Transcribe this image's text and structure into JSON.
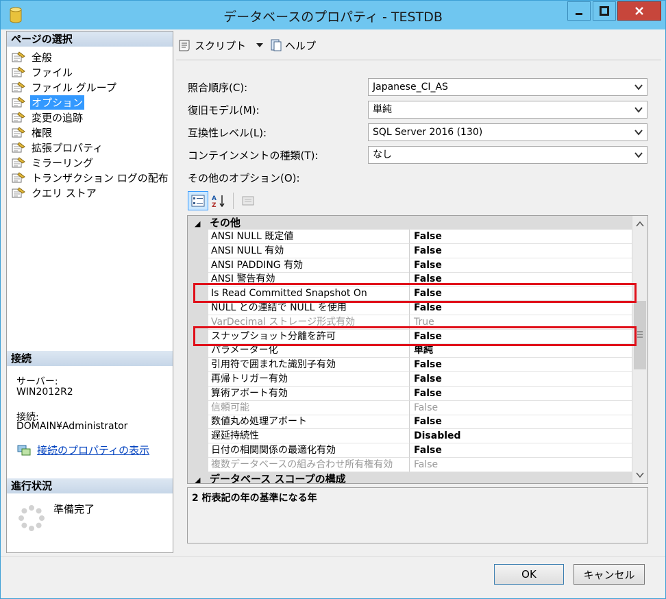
{
  "window": {
    "title": "データベースのプロパティ - TESTDB"
  },
  "left": {
    "page_select_header": "ページの選択",
    "nav_items": [
      {
        "label": "全般"
      },
      {
        "label": "ファイル"
      },
      {
        "label": "ファイル グループ"
      },
      {
        "label": "オプション",
        "selected": true
      },
      {
        "label": "変更の追跡"
      },
      {
        "label": "権限"
      },
      {
        "label": "拡張プロパティ"
      },
      {
        "label": "ミラーリング"
      },
      {
        "label": "トランザクション ログの配布"
      },
      {
        "label": "クエリ ストア"
      }
    ],
    "connection_header": "接続",
    "server_label": "サーバー:",
    "server_value": "WIN2012R2",
    "connection_label": "接続:",
    "connection_value": "DOMAIN¥Administrator",
    "connection_link": "接続のプロパティの表示",
    "progress_header": "進行状況",
    "progress_status": "準備完了"
  },
  "toolbar": {
    "script_label": "スクリプト",
    "help_label": "ヘルプ"
  },
  "form": {
    "collation_label": "照合順序(C):",
    "collation_value": "Japanese_CI_AS",
    "recovery_label": "復旧モデル(M):",
    "recovery_value": "単純",
    "compat_label": "互換性レベル(L):",
    "compat_value": "SQL Server 2016 (130)",
    "containment_label": "コンテインメントの種類(T):",
    "containment_value": "なし",
    "other_options_label": "その他のオプション(O):"
  },
  "grid": {
    "category_top": "その他",
    "rows": [
      {
        "name": "ANSI NULL 既定値",
        "value": "False",
        "disabled": false
      },
      {
        "name": "ANSI NULL 有効",
        "value": "False",
        "disabled": false
      },
      {
        "name": "ANSI PADDING 有効",
        "value": "False",
        "disabled": false
      },
      {
        "name": "ANSI 警告有効",
        "value": "False",
        "disabled": false
      },
      {
        "name": "Is Read Committed Snapshot On",
        "value": "False",
        "disabled": false
      },
      {
        "name": "NULL との連結で NULL を使用",
        "value": "False",
        "disabled": false
      },
      {
        "name": "VarDecimal ストレージ形式有効",
        "value": "True",
        "disabled": true
      },
      {
        "name": "スナップショット分離を許可",
        "value": "False",
        "disabled": false
      },
      {
        "name": "パラメーター化",
        "value": "単純",
        "disabled": false
      },
      {
        "name": "引用符で囲まれた識別子有効",
        "value": "False",
        "disabled": false
      },
      {
        "name": "再帰トリガー有効",
        "value": "False",
        "disabled": false
      },
      {
        "name": "算術アボート有効",
        "value": "False",
        "disabled": false
      },
      {
        "name": "信頼可能",
        "value": "False",
        "disabled": true
      },
      {
        "name": "数値丸め処理アボート",
        "value": "False",
        "disabled": false
      },
      {
        "name": "遅延持続性",
        "value": "Disabled",
        "disabled": false
      },
      {
        "name": "日付の相関関係の最適化有効",
        "value": "False",
        "disabled": false
      },
      {
        "name": "複数データベースの組み合わせ所有権有効",
        "value": "False",
        "disabled": true
      }
    ],
    "category_bottom": "データベース スコープの構成",
    "description": "2 桁表記の年の基準になる年"
  },
  "buttons": {
    "ok": "OK",
    "cancel": "キャンセル"
  },
  "colors": {
    "titlebar": "#6fc6f0",
    "selection": "#3399ff",
    "highlight": "#e0101a",
    "close_button": "#c7463b"
  }
}
